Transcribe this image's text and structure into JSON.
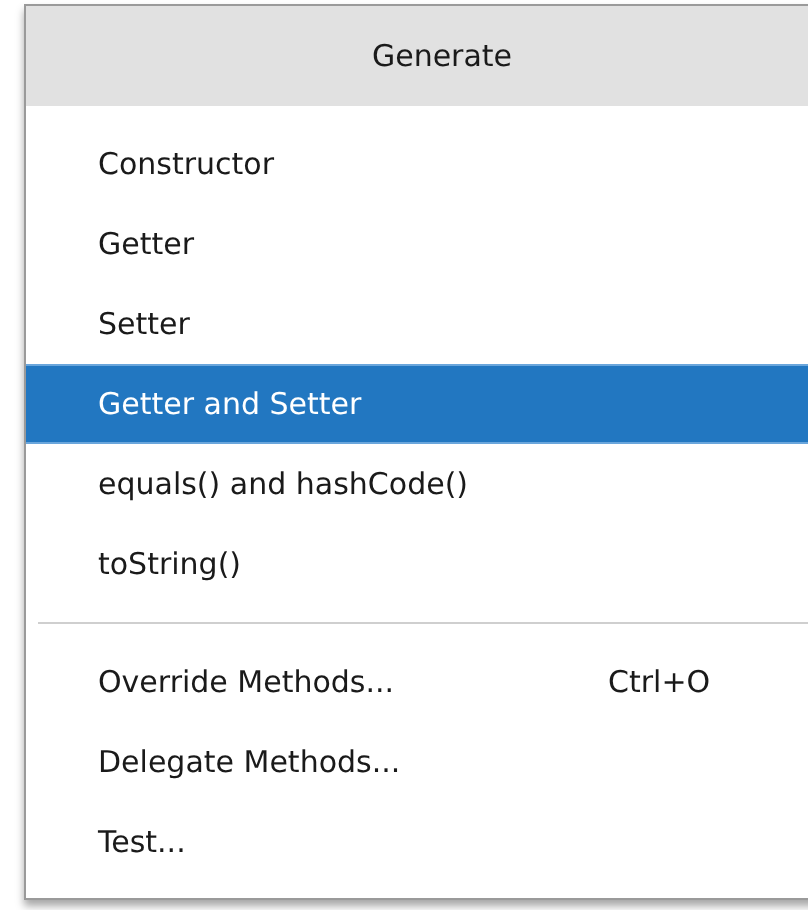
{
  "menu": {
    "title": "Generate",
    "sections": [
      {
        "items": [
          {
            "label": "Constructor",
            "selected": false
          },
          {
            "label": "Getter",
            "selected": false
          },
          {
            "label": "Setter",
            "selected": false
          },
          {
            "label": "Getter and Setter",
            "selected": true
          },
          {
            "label": "equals() and hashCode()",
            "selected": false
          },
          {
            "label": "toString()",
            "selected": false
          }
        ]
      },
      {
        "items": [
          {
            "label": "Override Methods...",
            "shortcut": "Ctrl+O",
            "selected": false
          },
          {
            "label": "Delegate Methods...",
            "selected": false
          },
          {
            "label": "Test...",
            "selected": false
          }
        ]
      }
    ]
  }
}
